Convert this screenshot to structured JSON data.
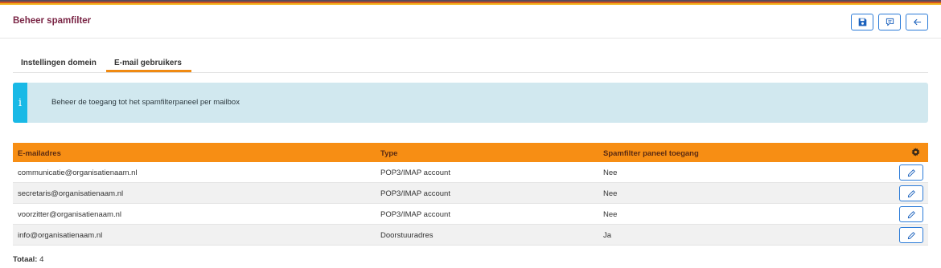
{
  "header": {
    "title": "Beheer spamfilter",
    "buttons": [
      {
        "name": "save-button",
        "icon": "floppy-disk-icon"
      },
      {
        "name": "comment-button",
        "icon": "comment-icon"
      },
      {
        "name": "back-button",
        "icon": "arrow-left-icon"
      }
    ]
  },
  "tabs": [
    {
      "label": "Instellingen domein",
      "active": false
    },
    {
      "label": "E-mail gebruikers",
      "active": true
    }
  ],
  "alert": {
    "icon": "info-icon",
    "text": "Beheer de toegang tot het spamfilterpaneel per mailbox"
  },
  "table": {
    "headers": {
      "email": "E-mailadres",
      "type": "Type",
      "access": "Spamfilter paneel toegang"
    },
    "settings_icon": "gear-icon",
    "rows": [
      {
        "email": "communicatie@organisatienaam.nl",
        "type": "POP3/IMAP account",
        "access": "Nee"
      },
      {
        "email": "secretaris@organisatienaam.nl",
        "type": "POP3/IMAP account",
        "access": "Nee"
      },
      {
        "email": "voorzitter@organisatienaam.nl",
        "type": "POP3/IMAP account",
        "access": "Nee"
      },
      {
        "email": "info@organisatienaam.nl",
        "type": "Doorstuuradres",
        "access": "Ja"
      }
    ]
  },
  "total": {
    "label": "Totaal:",
    "value": "4"
  },
  "colors": {
    "title": "#7a2545",
    "accent": "#f78e14",
    "info_bg": "#d1e8ef",
    "info_icon_bg": "#19b9e6",
    "button_border": "#2b7bd8"
  }
}
